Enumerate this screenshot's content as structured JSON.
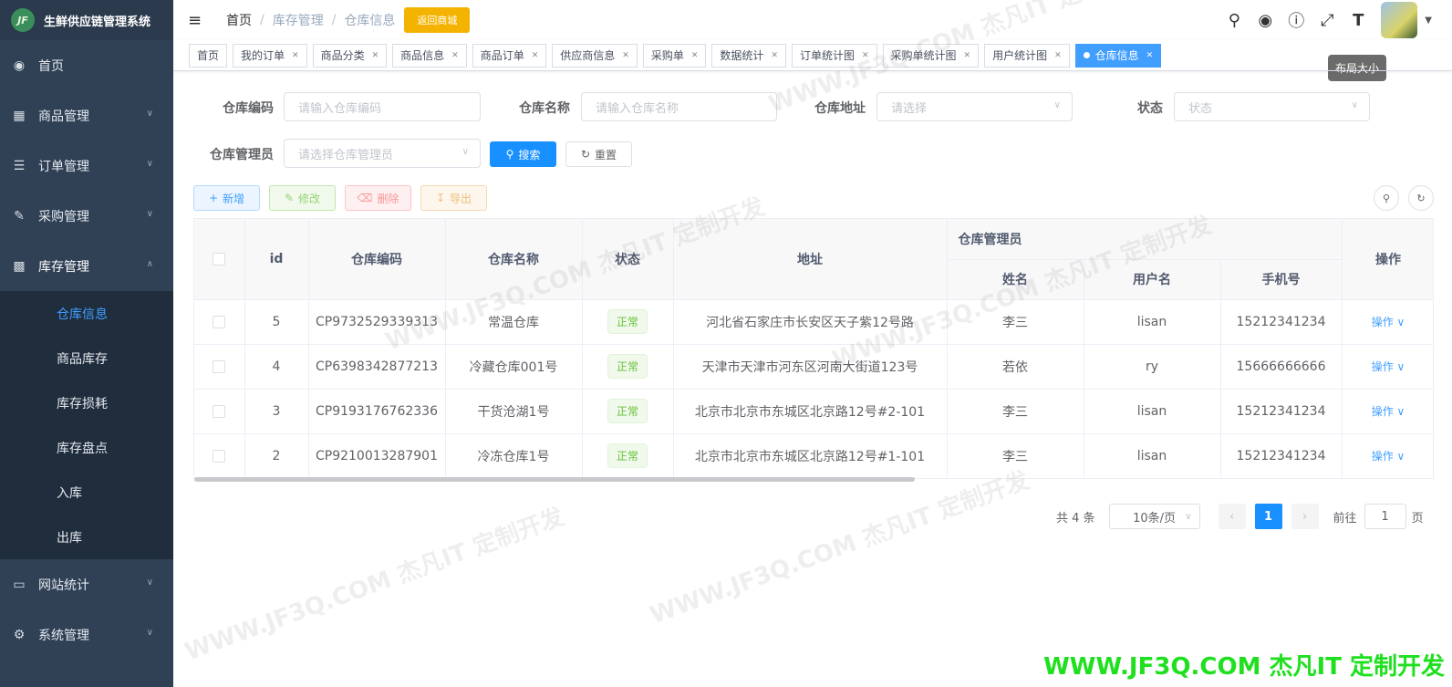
{
  "app": {
    "title": "生鲜供应链管理系统",
    "logo_text": "JF"
  },
  "sidebar": {
    "items": [
      {
        "label": "首页",
        "icon": "dashboard-icon"
      },
      {
        "label": "商品管理",
        "icon": "document-icon"
      },
      {
        "label": "订单管理",
        "icon": "list-icon"
      },
      {
        "label": "采购管理",
        "icon": "edit-icon"
      },
      {
        "label": "库存管理",
        "icon": "clipboard-icon",
        "expanded": true
      },
      {
        "label": "网站统计",
        "icon": "monitor-icon"
      },
      {
        "label": "系统管理",
        "icon": "gear-icon"
      }
    ],
    "submenu": [
      "仓库信息",
      "商品库存",
      "库存损耗",
      "库存盘点",
      "入库",
      "出库"
    ],
    "active_sub": "仓库信息"
  },
  "header": {
    "breadcrumb": [
      "首页",
      "库存管理",
      "仓库信息"
    ],
    "back_button": "返回商城",
    "tooltip": "布局大小"
  },
  "tags": [
    {
      "label": "首页",
      "closable": false
    },
    {
      "label": "我的订单",
      "closable": true
    },
    {
      "label": "商品分类",
      "closable": true
    },
    {
      "label": "商品信息",
      "closable": true
    },
    {
      "label": "商品订单",
      "closable": true
    },
    {
      "label": "供应商信息",
      "closable": true
    },
    {
      "label": "采购单",
      "closable": true
    },
    {
      "label": "数据统计",
      "closable": true
    },
    {
      "label": "订单统计图",
      "closable": true
    },
    {
      "label": "采购单统计图",
      "closable": true
    },
    {
      "label": "用户统计图",
      "closable": true
    },
    {
      "label": "仓库信息",
      "closable": true,
      "active": true
    }
  ],
  "search": {
    "code_label": "仓库编码",
    "code_placeholder": "请输入仓库编码",
    "name_label": "仓库名称",
    "name_placeholder": "请输入仓库名称",
    "address_label": "仓库地址",
    "address_placeholder": "请选择",
    "status_label": "状态",
    "status_placeholder": "状态",
    "manager_label": "仓库管理员",
    "manager_placeholder": "请选择仓库管理员",
    "search_btn": "搜索",
    "reset_btn": "重置"
  },
  "toolbar": {
    "add": "新增",
    "edit": "修改",
    "delete": "删除",
    "export": "导出"
  },
  "table": {
    "headers": {
      "id": "id",
      "code": "仓库编码",
      "name": "仓库名称",
      "status": "状态",
      "address": "地址",
      "manager_group": "仓库管理员",
      "manager_name": "姓名",
      "username": "用户名",
      "phone": "手机号",
      "actions": "操作"
    },
    "rows": [
      {
        "id": "5",
        "code": "CP9732529339313",
        "name": "常温仓库",
        "status": "正常",
        "address": "河北省石家庄市长安区天子紫12号路",
        "manager": "李三",
        "username": "lisan",
        "phone": "15212341234",
        "action": "操作"
      },
      {
        "id": "4",
        "code": "CP6398342877213",
        "name": "冷藏仓库001号",
        "status": "正常",
        "address": "天津市天津市河东区河南大街道123号",
        "manager": "若依",
        "username": "ry",
        "phone": "15666666666",
        "action": "操作"
      },
      {
        "id": "3",
        "code": "CP9193176762336",
        "name": "干货沧湖1号",
        "status": "正常",
        "address": "北京市北京市东城区北京路12号#2-101",
        "manager": "李三",
        "username": "lisan",
        "phone": "15212341234",
        "action": "操作"
      },
      {
        "id": "2",
        "code": "CP9210013287901",
        "name": "冷冻仓库1号",
        "status": "正常",
        "address": "北京市北京市东城区北京路12号#1-101",
        "manager": "李三",
        "username": "lisan",
        "phone": "15212341234",
        "action": "操作"
      }
    ]
  },
  "pagination": {
    "total": "共 4 条",
    "page_size": "10条/页",
    "current": "1",
    "goto_label": "前往",
    "goto_value": "1",
    "page_suffix": "页"
  },
  "watermark": {
    "text1": "WWW.JF3Q.COM 杰凡IT 定制开发",
    "text2": "WWW.JF3Q.COM 杰凡IT 定制开发"
  }
}
